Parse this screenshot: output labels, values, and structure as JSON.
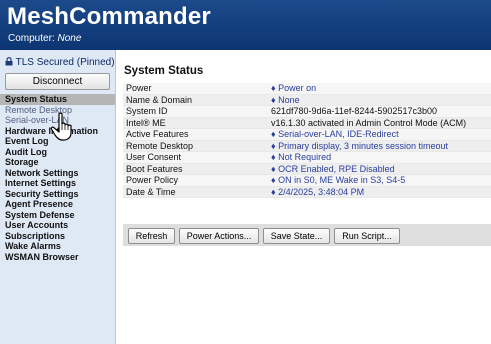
{
  "header": {
    "title": "MeshCommander",
    "computer_label": "Computer:",
    "computer_value": "None"
  },
  "sidebar": {
    "tls_status": "TLS Secured (Pinned)",
    "disconnect_label": "Disconnect",
    "items": [
      {
        "label": "System Status",
        "state": "active"
      },
      {
        "label": "Remote Desktop",
        "state": "light"
      },
      {
        "label": "Serial-over-LAN",
        "state": "light"
      },
      {
        "label": "Hardware Information",
        "state": "normal"
      },
      {
        "label": "Event Log",
        "state": "normal"
      },
      {
        "label": "Audit Log",
        "state": "normal"
      },
      {
        "label": "Storage",
        "state": "normal"
      },
      {
        "label": "Network Settings",
        "state": "normal"
      },
      {
        "label": "Internet Settings",
        "state": "normal"
      },
      {
        "label": "Security Settings",
        "state": "normal"
      },
      {
        "label": "Agent Presence",
        "state": "normal"
      },
      {
        "label": "System Defense",
        "state": "normal"
      },
      {
        "label": "User Accounts",
        "state": "normal"
      },
      {
        "label": "Subscriptions",
        "state": "normal"
      },
      {
        "label": "Wake Alarms",
        "state": "normal"
      },
      {
        "label": "WSMAN Browser",
        "state": "normal"
      }
    ]
  },
  "main": {
    "section_title": "System Status",
    "rows": [
      {
        "label": "Power",
        "value": "♦ Power on",
        "link": true
      },
      {
        "label": "Name & Domain",
        "value": "♦ None",
        "link": true
      },
      {
        "label": "System ID",
        "value": "621df780-9d6a-11ef-8244-5902517c3b00",
        "link": false
      },
      {
        "label": "Intel® ME",
        "value": "v16.1.30 activated in Admin Control Mode (ACM)",
        "link": false
      },
      {
        "label": "Active Features",
        "value": "♦ Serial-over-LAN, IDE-Redirect",
        "link": true
      },
      {
        "label": "Remote Desktop",
        "value": "♦ Primary display, 3 minutes session timeout",
        "link": true
      },
      {
        "label": "User Consent",
        "value": "♦ Not Required",
        "link": true
      },
      {
        "label": "Boot Features",
        "value": "♦ OCR Enabled, RPE Disabled",
        "link": true
      },
      {
        "label": "Power Policy",
        "value": "♦ ON in S0, ME Wake in S3, S4-5",
        "link": true
      },
      {
        "label": "Date & Time",
        "value": "♦ 2/4/2025, 3:48:04 PM",
        "link": true
      }
    ],
    "buttons": {
      "refresh": "Refresh",
      "power_actions": "Power Actions...",
      "save_state": "Save State...",
      "run_script": "Run Script..."
    }
  },
  "colors": {
    "header": "#0d3573",
    "sidebar": "#dfe9f6",
    "link": "#2a3e9e",
    "active_item": "#b5b5b5"
  },
  "icons": [
    "lock-icon",
    "hand-pointer-cursor"
  ]
}
